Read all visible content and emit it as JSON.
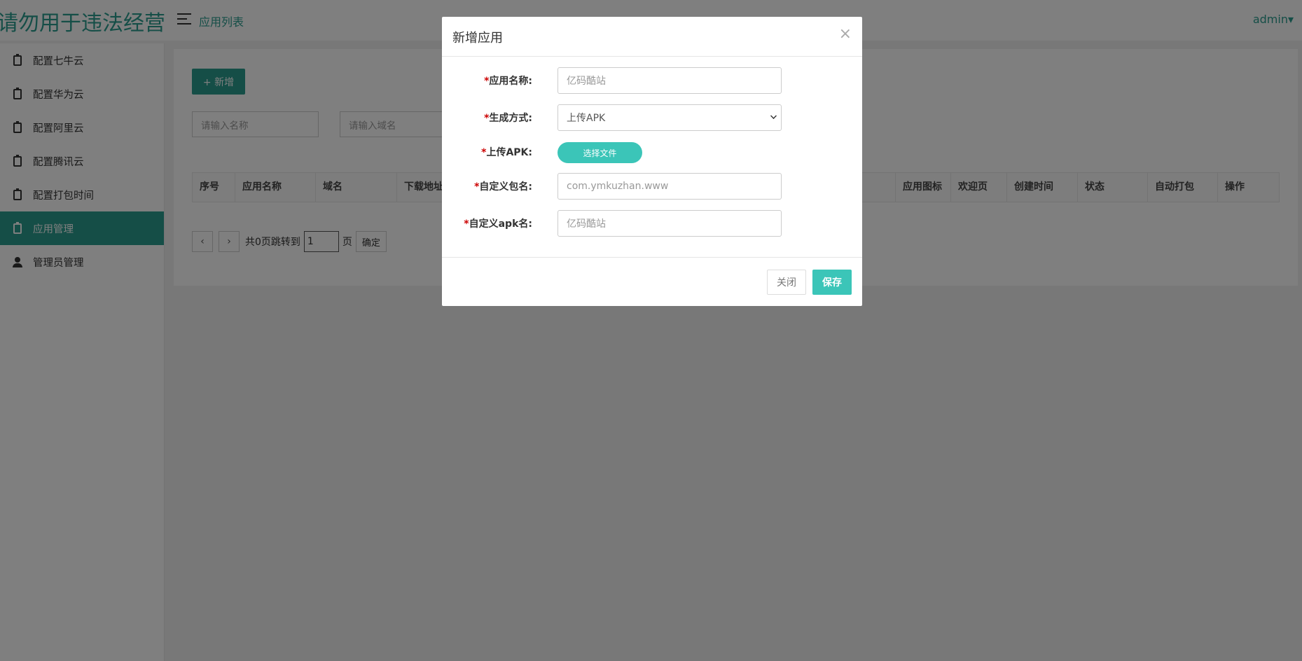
{
  "header": {
    "logo": "请勿用于违法经营",
    "breadcrumb": "应用列表",
    "user": "admin▾"
  },
  "sidebar": {
    "items": [
      {
        "label": "配置七牛云",
        "icon": "clipboard-icon",
        "active": false
      },
      {
        "label": "配置华为云",
        "icon": "clipboard-icon",
        "active": false
      },
      {
        "label": "配置阿里云",
        "icon": "clipboard-icon",
        "active": false
      },
      {
        "label": "配置腾讯云",
        "icon": "clipboard-icon",
        "active": false
      },
      {
        "label": "配置打包时间",
        "icon": "clipboard-icon",
        "active": false
      },
      {
        "label": "应用管理",
        "icon": "clipboard-icon",
        "active": true
      },
      {
        "label": "管理员管理",
        "icon": "user-icon",
        "active": false
      }
    ]
  },
  "main": {
    "add_button": "+ 新增",
    "search_name_placeholder": "请输入名称",
    "search_domain_placeholder": "请输入域名",
    "table_headers": [
      "序号",
      "应用名称",
      "域名",
      "下载地址",
      "应用图标",
      "欢迎页",
      "创建时间",
      "状态",
      "自动打包",
      "操作"
    ],
    "pager": {
      "prev": "‹",
      "next": "›",
      "summary": "共0页跳转到",
      "page_value": "1",
      "page_unit": "页",
      "confirm": "确定"
    }
  },
  "modal": {
    "title": "新增应用",
    "close_glyph": "×",
    "fields": {
      "app_name": {
        "label": "应用名称:",
        "placeholder": "亿码酷站"
      },
      "gen_method": {
        "label": "生成方式:",
        "value": "上传APK"
      },
      "upload_apk": {
        "label": "上传APK:",
        "button": "选择文件"
      },
      "package_name": {
        "label": "自定义包名:",
        "placeholder": "com.ymkuzhan.www"
      },
      "apk_name": {
        "label": "自定义apk名:",
        "placeholder": "亿码酷站"
      }
    },
    "required_mark": "*",
    "close_button": "关闭",
    "save_button": "保存"
  },
  "colors": {
    "accent": "#2a9d8f",
    "button_teal": "#3bc5b8",
    "required": "#cc0000"
  }
}
